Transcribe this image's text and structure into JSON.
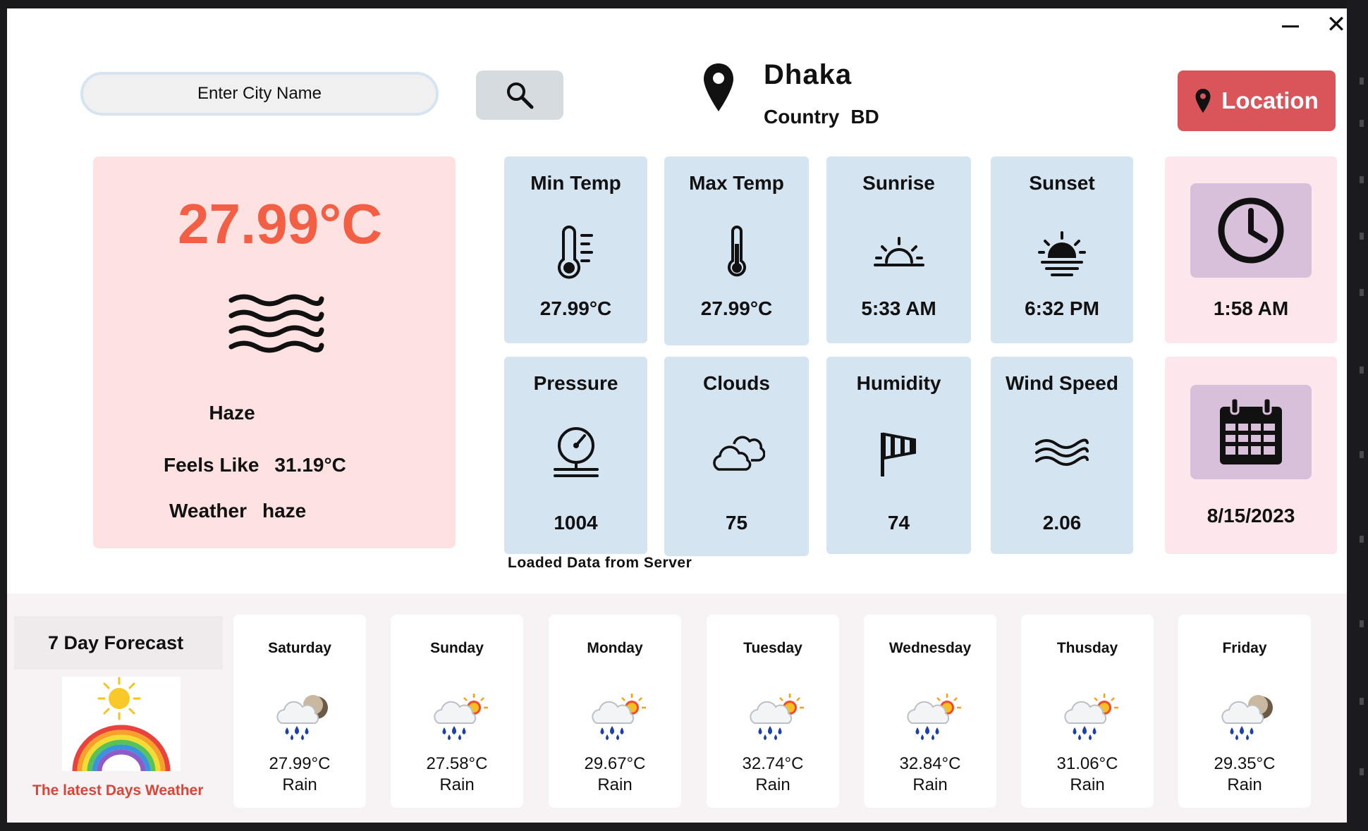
{
  "search": {
    "placeholder": "Enter City Name"
  },
  "location": {
    "city": "Dhaka",
    "country_label": "Country",
    "country_code": "BD",
    "button_label": "Location"
  },
  "current": {
    "temperature": "27.99°C",
    "condition": "Haze",
    "feels_like_label": "Feels Like",
    "feels_like_value": "31.19°C",
    "weather_label": "Weather",
    "weather_value": "haze"
  },
  "metrics": [
    {
      "label": "Min Temp",
      "value": "27.99°C",
      "icon": "thermometer-low-icon"
    },
    {
      "label": "Max Temp",
      "value": "27.99°C",
      "icon": "thermometer-icon"
    },
    {
      "label": "Sunrise",
      "value": "5:33 AM",
      "icon": "sunrise-icon"
    },
    {
      "label": "Sunset",
      "value": "6:32 PM",
      "icon": "sunset-icon"
    },
    {
      "label": "Pressure",
      "value": "1004",
      "icon": "pressure-gauge-icon"
    },
    {
      "label": "Clouds",
      "value": "75",
      "icon": "cloud-icon"
    },
    {
      "label": "Humidity",
      "value": "74",
      "icon": "windsock-icon"
    },
    {
      "label": "Wind Speed",
      "value": "2.06",
      "icon": "wind-waves-icon"
    }
  ],
  "clock": {
    "time": "1:58 AM",
    "date": "8/15/2023"
  },
  "status_message": "Loaded Data from Server",
  "forecast": {
    "title": "7 Day Forecast",
    "caption": "The latest Days Weather",
    "days": [
      {
        "day": "Saturday",
        "temp": "27.99°C",
        "desc": "Rain",
        "icon": "rain-night-icon"
      },
      {
        "day": "Sunday",
        "temp": "27.58°C",
        "desc": "Rain",
        "icon": "rain-sun-icon"
      },
      {
        "day": "Monday",
        "temp": "29.67°C",
        "desc": "Rain",
        "icon": "rain-sun-icon"
      },
      {
        "day": "Tuesday",
        "temp": "32.74°C",
        "desc": "Rain",
        "icon": "rain-sun-icon"
      },
      {
        "day": "Wednesday",
        "temp": "32.84°C",
        "desc": "Rain",
        "icon": "rain-sun-icon"
      },
      {
        "day": "Thusday",
        "temp": "31.06°C",
        "desc": "Rain",
        "icon": "rain-sun-icon"
      },
      {
        "day": "Friday",
        "temp": "29.35°C",
        "desc": "Rain",
        "icon": "rain-night-icon"
      }
    ]
  },
  "colors": {
    "accent_red": "#d9555a",
    "temp_orange": "#f25f44",
    "tile_blue": "#d5e4f1",
    "current_card_pink": "#fde2e1",
    "side_card_pink": "#fde7ec",
    "badge_mauve": "#d8bfda"
  }
}
